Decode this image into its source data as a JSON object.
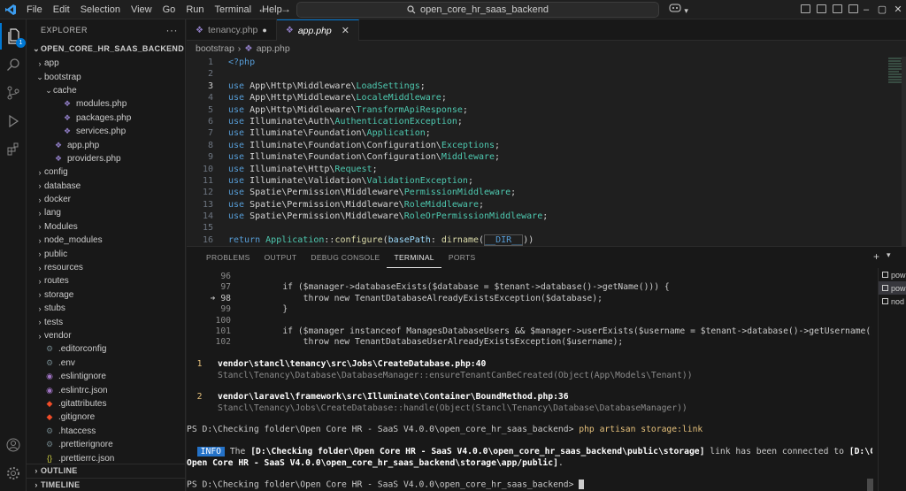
{
  "titlebar": {
    "menu": [
      "File",
      "Edit",
      "Selection",
      "View",
      "Go",
      "Run",
      "Terminal",
      "Help"
    ],
    "search": "open_core_hr_saas_backend",
    "logo_icon": "vscode-logo-icon"
  },
  "activitybar": {
    "items": [
      "explorer-icon",
      "search-icon",
      "source-control-icon",
      "run-debug-icon",
      "extensions-icon"
    ],
    "explorer_badge": "1",
    "bottom": [
      "account-icon",
      "manage-gear-icon"
    ]
  },
  "sidebar": {
    "header": "EXPLORER",
    "root": "OPEN_CORE_HR_SAAS_BACKEND",
    "tree": [
      {
        "label": "app",
        "indent": 1,
        "kind": "folder",
        "open": false
      },
      {
        "label": "bootstrap",
        "indent": 1,
        "kind": "folder",
        "open": true
      },
      {
        "label": "cache",
        "indent": 2,
        "kind": "folder",
        "open": true
      },
      {
        "label": "modules.php",
        "indent": 3,
        "kind": "php"
      },
      {
        "label": "packages.php",
        "indent": 3,
        "kind": "php"
      },
      {
        "label": "services.php",
        "indent": 3,
        "kind": "php"
      },
      {
        "label": "app.php",
        "indent": 2,
        "kind": "php"
      },
      {
        "label": "providers.php",
        "indent": 2,
        "kind": "php"
      },
      {
        "label": "config",
        "indent": 1,
        "kind": "folder",
        "open": false
      },
      {
        "label": "database",
        "indent": 1,
        "kind": "folder",
        "open": false
      },
      {
        "label": "docker",
        "indent": 1,
        "kind": "folder",
        "open": false
      },
      {
        "label": "lang",
        "indent": 1,
        "kind": "folder",
        "open": false
      },
      {
        "label": "Modules",
        "indent": 1,
        "kind": "folder",
        "open": false
      },
      {
        "label": "node_modules",
        "indent": 1,
        "kind": "folder",
        "open": false
      },
      {
        "label": "public",
        "indent": 1,
        "kind": "folder",
        "open": false
      },
      {
        "label": "resources",
        "indent": 1,
        "kind": "folder",
        "open": false
      },
      {
        "label": "routes",
        "indent": 1,
        "kind": "folder",
        "open": false
      },
      {
        "label": "storage",
        "indent": 1,
        "kind": "folder",
        "open": false
      },
      {
        "label": "stubs",
        "indent": 1,
        "kind": "folder",
        "open": false
      },
      {
        "label": "tests",
        "indent": 1,
        "kind": "folder",
        "open": false
      },
      {
        "label": "vendor",
        "indent": 1,
        "kind": "folder",
        "open": false
      },
      {
        "label": ".editorconfig",
        "indent": 1,
        "kind": "gear"
      },
      {
        "label": ".env",
        "indent": 1,
        "kind": "gear"
      },
      {
        "label": ".eslintignore",
        "indent": 1,
        "kind": "lint"
      },
      {
        "label": ".eslintrc.json",
        "indent": 1,
        "kind": "lint"
      },
      {
        "label": ".gitattributes",
        "indent": 1,
        "kind": "git"
      },
      {
        "label": ".gitignore",
        "indent": 1,
        "kind": "git"
      },
      {
        "label": ".htaccess",
        "indent": 1,
        "kind": "gear"
      },
      {
        "label": ".prettierignore",
        "indent": 1,
        "kind": "gear"
      },
      {
        "label": ".prettierrc.json",
        "indent": 1,
        "kind": "json"
      }
    ],
    "outline": "OUTLINE",
    "timeline": "TIMELINE"
  },
  "editor": {
    "tabs": [
      {
        "label": "tenancy.php",
        "active": false,
        "modified": true
      },
      {
        "label": "app.php",
        "active": true,
        "modified": false
      }
    ],
    "breadcrumbs": [
      "bootstrap",
      "app.php"
    ],
    "lines": [
      {
        "n": "1",
        "t": "<?php"
      },
      {
        "n": "2",
        "t": ""
      },
      {
        "n": "3",
        "t": "use App\\Http\\Middleware\\LoadSettings;",
        "cur": true
      },
      {
        "n": "4",
        "t": "use App\\Http\\Middleware\\LocaleMiddleware;"
      },
      {
        "n": "5",
        "t": "use App\\Http\\Middleware\\TransformApiResponse;"
      },
      {
        "n": "6",
        "t": "use Illuminate\\Auth\\AuthenticationException;"
      },
      {
        "n": "7",
        "t": "use Illuminate\\Foundation\\Application;"
      },
      {
        "n": "8",
        "t": "use Illuminate\\Foundation\\Configuration\\Exceptions;"
      },
      {
        "n": "9",
        "t": "use Illuminate\\Foundation\\Configuration\\Middleware;"
      },
      {
        "n": "10",
        "t": "use Illuminate\\Http\\Request;"
      },
      {
        "n": "11",
        "t": "use Illuminate\\Validation\\ValidationException;"
      },
      {
        "n": "12",
        "t": "use Spatie\\Permission\\Middleware\\PermissionMiddleware;"
      },
      {
        "n": "13",
        "t": "use Spatie\\Permission\\Middleware\\RoleMiddleware;"
      },
      {
        "n": "14",
        "t": "use Spatie\\Permission\\Middleware\\RoleOrPermissionMiddleware;"
      },
      {
        "n": "15",
        "t": ""
      },
      {
        "n": "16",
        "t": "return Application::configure(basePath: dirname(__DIR__))"
      }
    ]
  },
  "panel": {
    "tabs": [
      "PROBLEMS",
      "OUTPUT",
      "DEBUG CONSOLE",
      "TERMINAL",
      "PORTS"
    ],
    "active_tab": "TERMINAL",
    "terminals": [
      "pow",
      "pow",
      "nod"
    ],
    "terminal": {
      "src_lines": [
        {
          "n": "96",
          "t": ""
        },
        {
          "n": "97",
          "t": "        if ($manager->databaseExists($database = $tenant->database()->getName())) {"
        },
        {
          "n": "98",
          "t": "            throw new TenantDatabaseAlreadyExistsException($database);",
          "arrow": true
        },
        {
          "n": "99",
          "t": "        }"
        },
        {
          "n": "100",
          "t": ""
        },
        {
          "n": "101",
          "t": "        if ($manager instanceof ManagesDatabaseUsers && $manager->userExists($username = $tenant->database()->getUsername())) {"
        },
        {
          "n": "102",
          "t": "            throw new TenantDatabaseUserAlreadyExistsException($username);"
        }
      ],
      "frames": [
        {
          "num": "1",
          "file": "vendor\\stancl\\tenancy\\src\\Jobs\\CreateDatabase.php:40",
          "sub": "Stancl\\Tenancy\\Database\\DatabaseManager::ensureTenantCanBeCreated(Object(App\\Models\\Tenant))"
        },
        {
          "num": "2",
          "file": "vendor\\laravel\\framework\\src\\Illuminate\\Container\\BoundMethod.php:36",
          "sub": "Stancl\\Tenancy\\Jobs\\CreateDatabase::handle(Object(Stancl\\Tenancy\\Database\\DatabaseManager))"
        }
      ],
      "prompt": "PS D:\\Checking folder\\Open Core HR - SaaS V4.0.0\\open_core_hr_saas_backend>",
      "command": "php artisan storage:link",
      "info_badge": "INFO",
      "info_pre": " The ",
      "info_path1": "[D:\\Checking folder\\Open Core HR - SaaS V4.0.0\\open_core_hr_saas_backend\\public\\storage]",
      "info_mid": " link has been connected to ",
      "info_path2a": "[D:\\Checking folder\\",
      "info_path2b": "Open Core HR - SaaS V4.0.0\\open_core_hr_saas_backend\\storage\\app/public]",
      "info_end": ".",
      "prompt2": "PS D:\\Checking folder\\Open Core HR - SaaS V4.0.0\\open_core_hr_saas_backend>"
    }
  },
  "colors": {
    "accent": "#0078d4",
    "php_icon": "#8e7cc3",
    "info_badge": "#2472c8"
  }
}
